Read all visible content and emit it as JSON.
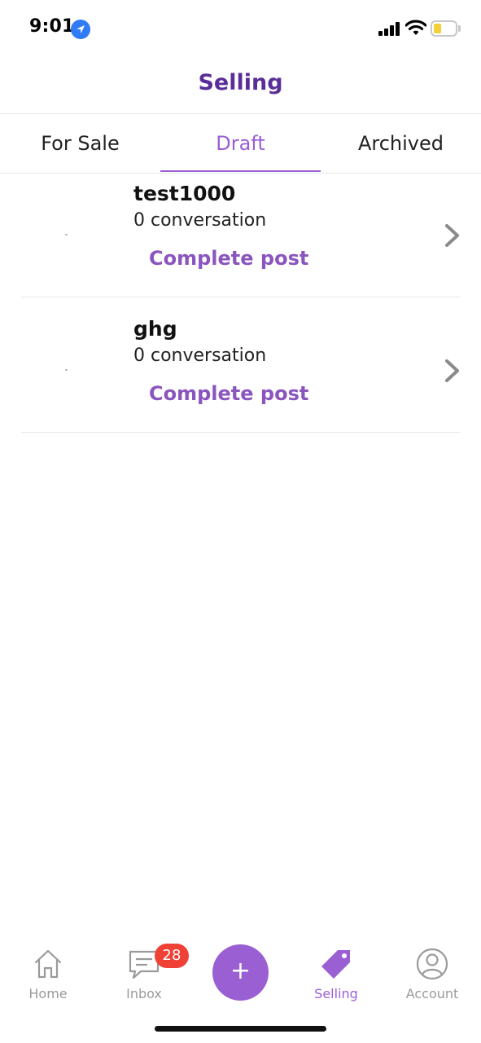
{
  "status_bar": {
    "time": "9:01",
    "icons": [
      "location-arrow-icon",
      "cellular-signal-icon",
      "wifi-icon",
      "battery-low-icon"
    ]
  },
  "header": {
    "title": "Selling"
  },
  "tabs": [
    {
      "label": "For Sale",
      "active": false
    },
    {
      "label": "Draft",
      "active": true
    },
    {
      "label": "Archived",
      "active": false
    }
  ],
  "listings": [
    {
      "title": "test1000",
      "subtitle": "0 conversation",
      "action": "Complete post",
      "icon": "chevron-right-icon"
    },
    {
      "title": "ghg",
      "subtitle": "0 conversation",
      "action": "Complete post",
      "icon": "chevron-right-icon"
    }
  ],
  "bottom_nav": {
    "items": [
      {
        "label": "Home",
        "icon": "home-icon",
        "active": false
      },
      {
        "label": "Inbox",
        "icon": "chat-icon",
        "active": false,
        "badge": "28"
      },
      {
        "label": "",
        "icon": "plus-icon",
        "fab_label": "+"
      },
      {
        "label": "Selling",
        "icon": "price-tag-icon",
        "active": true
      },
      {
        "label": "Account",
        "icon": "account-icon",
        "active": false
      }
    ]
  },
  "colors": {
    "accent": "#9b5fd4",
    "title": "#5a2e98",
    "badge": "#ef4136",
    "inactive": "#9a9a9a"
  }
}
